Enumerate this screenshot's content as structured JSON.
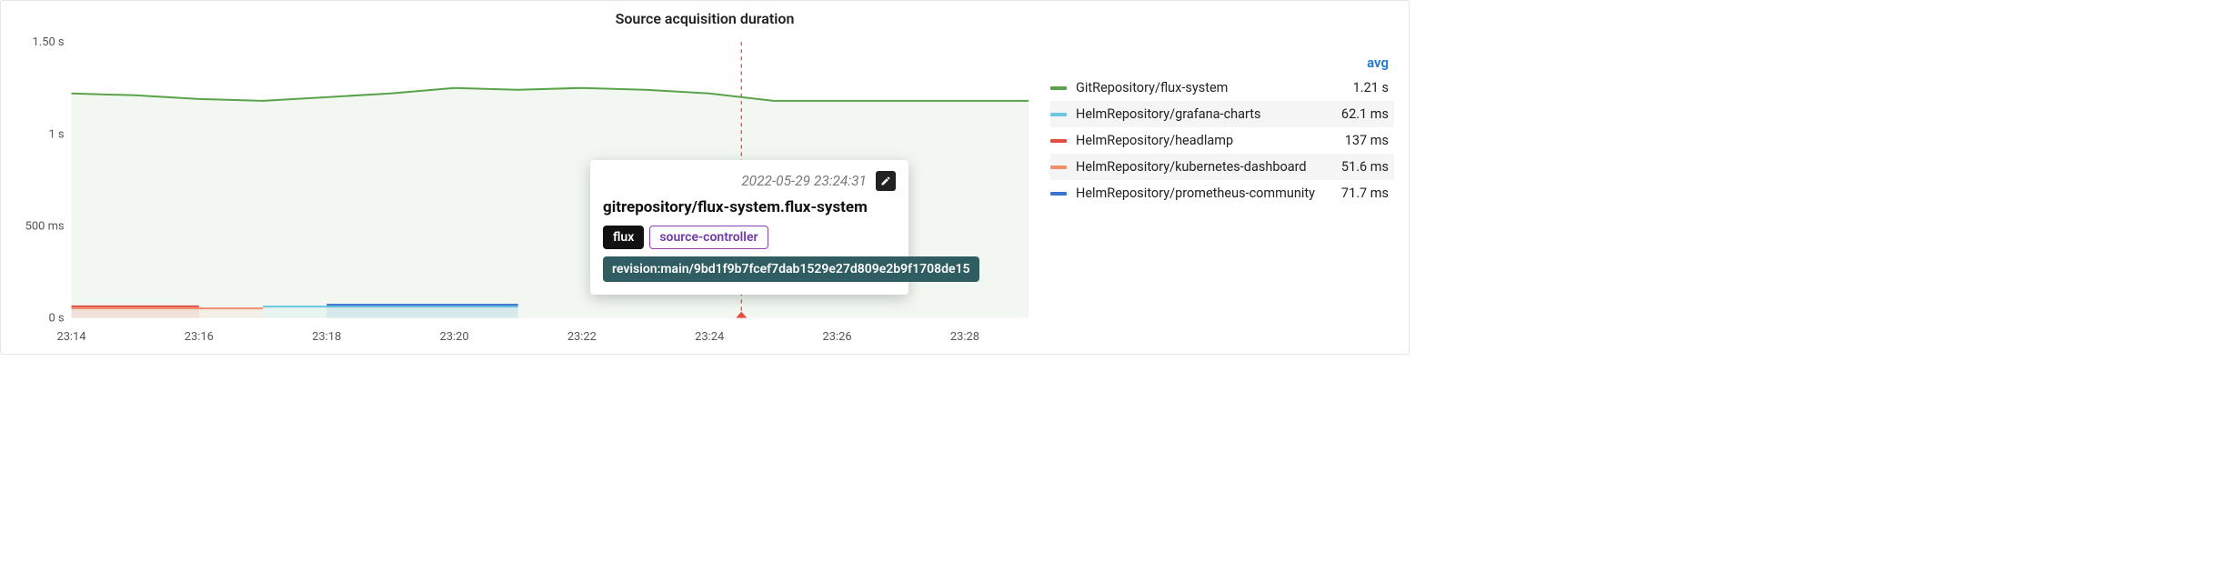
{
  "title": "Source acquisition duration",
  "legend": {
    "header": "avg",
    "items": [
      {
        "label": "GitRepository/flux-system",
        "value": "1.21 s",
        "color": "#5aa34a"
      },
      {
        "label": "HelmRepository/grafana-charts",
        "value": "62.1 ms",
        "color": "#6cc8e0"
      },
      {
        "label": "HelmRepository/headlamp",
        "value": "137 ms",
        "color": "#e24d42"
      },
      {
        "label": "HelmRepository/kubernetes-dashboard",
        "value": "51.6 ms",
        "color": "#f08f6a"
      },
      {
        "label": "HelmRepository/prometheus-community",
        "value": "71.7 ms",
        "color": "#3973d0"
      }
    ]
  },
  "tooltip": {
    "time": "2022-05-29 23:24:31",
    "title": "gitrepository/flux-system.flux-system",
    "tags": [
      {
        "text": "flux",
        "cls": "dark"
      },
      {
        "text": "source-controller",
        "cls": "purple"
      }
    ],
    "revision": "revision:main/9bd1f9b7fcef7dab1529e27d809e2b9f1708de15"
  },
  "chart_data": {
    "type": "line",
    "title": "Source acquisition duration",
    "xlabel": "",
    "ylabel": "",
    "ylim": [
      0,
      1.5
    ],
    "y_ticks": [
      {
        "v": 0,
        "label": "0 s"
      },
      {
        "v": 0.5,
        "label": "500 ms"
      },
      {
        "v": 1.0,
        "label": "1 s"
      },
      {
        "v": 1.5,
        "label": "1.50 s"
      }
    ],
    "x_ticks": [
      "23:14",
      "23:16",
      "23:18",
      "23:20",
      "23:22",
      "23:24",
      "23:26",
      "23:28"
    ],
    "x": [
      "23:14",
      "23:15",
      "23:16",
      "23:17",
      "23:18",
      "23:19",
      "23:20",
      "23:21",
      "23:22",
      "23:23",
      "23:24",
      "23:25",
      "23:26",
      "23:27",
      "23:28",
      "23:29"
    ],
    "series": [
      {
        "name": "GitRepository/flux-system",
        "color": "#5aa34a",
        "values": [
          1.22,
          1.21,
          1.19,
          1.18,
          1.2,
          1.22,
          1.25,
          1.24,
          1.25,
          1.24,
          1.22,
          1.18,
          1.18,
          1.18,
          1.18,
          1.18
        ]
      },
      {
        "name": "HelmRepository/headlamp",
        "color": "#e24d42",
        "values": [
          0.063,
          0.063,
          0.063,
          null,
          null,
          null,
          null,
          null,
          null,
          null,
          null,
          null,
          null,
          null,
          null,
          null
        ]
      },
      {
        "name": "HelmRepository/kubernetes-dashboard",
        "color": "#f08f6a",
        "values": [
          0.052,
          0.052,
          0.052,
          0.052,
          null,
          null,
          null,
          null,
          null,
          null,
          null,
          null,
          null,
          null,
          null,
          null
        ]
      },
      {
        "name": "HelmRepository/grafana-charts",
        "color": "#6cc8e0",
        "values": [
          null,
          null,
          null,
          0.062,
          0.062,
          0.062,
          0.062,
          0.062,
          null,
          null,
          null,
          null,
          null,
          null,
          null,
          null
        ]
      },
      {
        "name": "HelmRepository/prometheus-community",
        "color": "#3973d0",
        "values": [
          null,
          null,
          null,
          null,
          0.072,
          0.072,
          0.072,
          0.072,
          null,
          null,
          null,
          null,
          null,
          null,
          null,
          null
        ]
      }
    ],
    "hover_x": "23:24.5",
    "annotations_x": [
      "23:24.5"
    ]
  }
}
